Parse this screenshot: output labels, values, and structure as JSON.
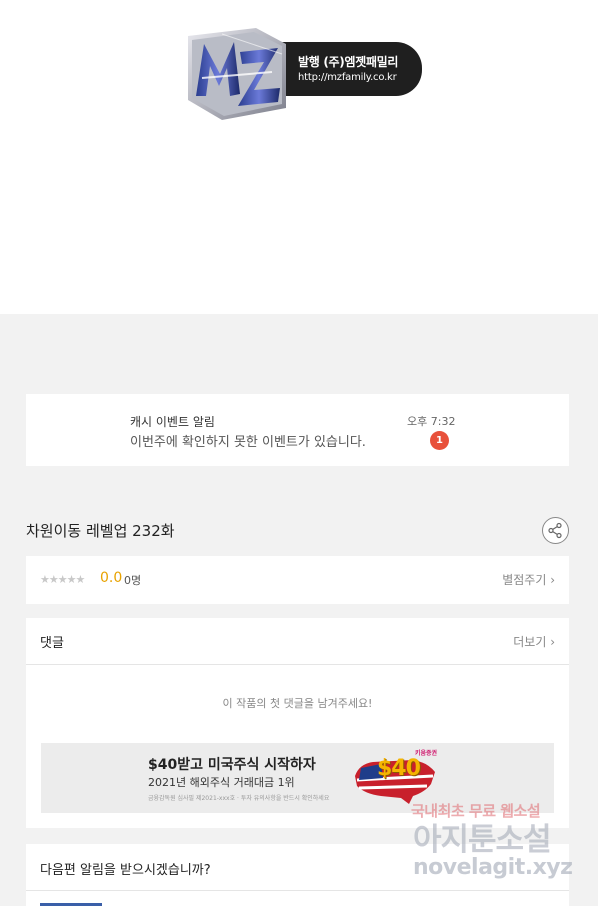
{
  "publisher": {
    "logo_text": "MZ",
    "line1": "발행 (주)엠젯패밀리",
    "line2": "http://mzfamily.co.kr"
  },
  "notice": {
    "title": "캐시 이벤트 알림",
    "message": "이번주에 확인하지 못한 이벤트가 있습니다.",
    "time": "오후 7:32",
    "badge": "1",
    "badge_color": "#e8503a"
  },
  "episode": {
    "title": "차원이동 레벨업 232화",
    "share_icon": "share-icon"
  },
  "rating": {
    "stars": "★★★★★",
    "score": "0.0",
    "count": "0명",
    "rate_link": "별점주기",
    "score_color": "#e8a200"
  },
  "comments": {
    "title": "댓글",
    "more": "더보기",
    "empty": "이 작품의 첫 댓글을 남겨주세요!"
  },
  "ad": {
    "headline": "$40받고 미국주식 시작하자",
    "sub": "2021년 해외주식 거래대금 1위",
    "fine": "금융감독원 심사필 제2021-xxx호 · 투자 유의사항을 반드시 확인하세요",
    "price": "$40",
    "tag": "키움증권"
  },
  "next": {
    "title": "다음편 알림을 받으시겠습니까?"
  },
  "watermark": {
    "line1": "국내최초 무료 웹소설",
    "line2": "아지툰소설",
    "line3": "novelagit.xyz"
  }
}
